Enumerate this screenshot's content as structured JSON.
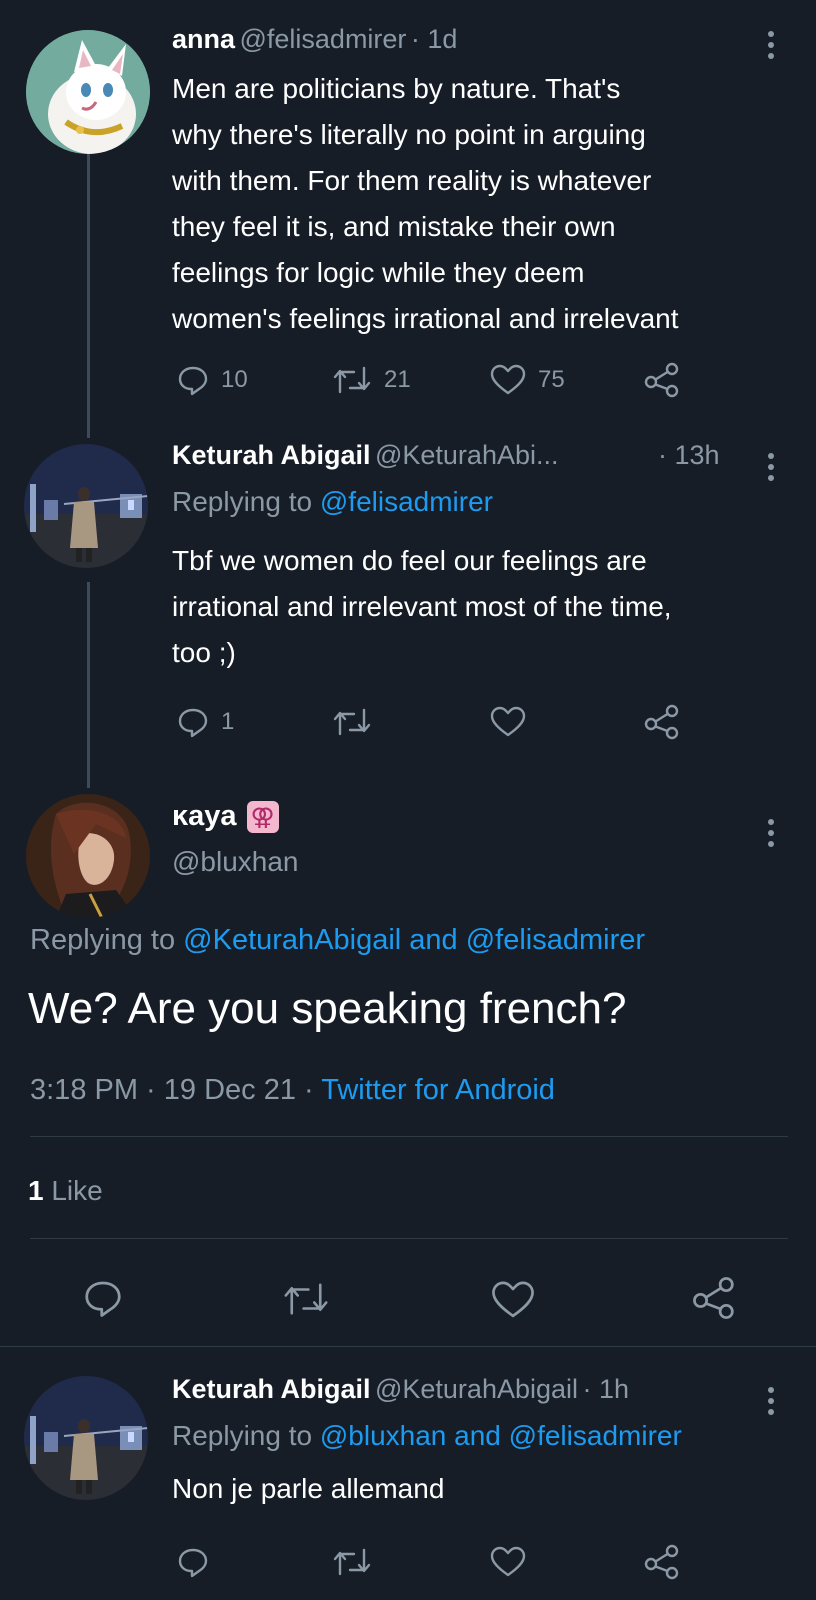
{
  "tweet1": {
    "name": "anna",
    "handle": "@felisadmirer",
    "time": "· 1d",
    "lines": [
      "Men are politicians by nature. That's",
      "why there's literally no point in arguing",
      "with them. For them reality is whatever",
      "they feel it is, and mistake their own",
      "feelings for logic while they deem",
      "women's feelings irrational and irrelevant"
    ],
    "replies": "10",
    "retweets": "21",
    "likes": "75"
  },
  "tweet2": {
    "name": "Keturah Abigail",
    "handle": "@KeturahAbi...",
    "time": "· 13h",
    "replying_prefix": "Replying to",
    "replying_to": "@felisadmirer",
    "lines": [
      "Tbf we women do feel our feelings are",
      "irrational and irrelevant most of the time,",
      "too ;)"
    ],
    "replies": "1"
  },
  "main_tweet": {
    "name": "ĸaya",
    "name_badge": "⚢",
    "handle": "@bluxhan",
    "replying_prefix": "Replying to",
    "replying_to": "@KeturahAbigail and @felisadmirer",
    "text": "We? Are you speaking french?",
    "timestamp": "3:18 PM · 19 Dec 21 · ",
    "source": "Twitter for Android",
    "likes_count": "1",
    "likes_label": "Like"
  },
  "tweet3": {
    "name": "Keturah Abigail",
    "handle": "@KeturahAbigail",
    "time": "· 1h",
    "replying_prefix": "Replying to",
    "replying_to": "@bluxhan and @felisadmirer",
    "text": "Non je parle allemand"
  },
  "colors": {
    "background": "#161d27",
    "secondary_text": "#8b98a5",
    "link": "#1d9bf0",
    "thread_line": "#3a4b5d"
  },
  "icons": [
    "more-vertical-icon",
    "reply-icon",
    "retweet-icon",
    "like-icon",
    "share-icon"
  ]
}
